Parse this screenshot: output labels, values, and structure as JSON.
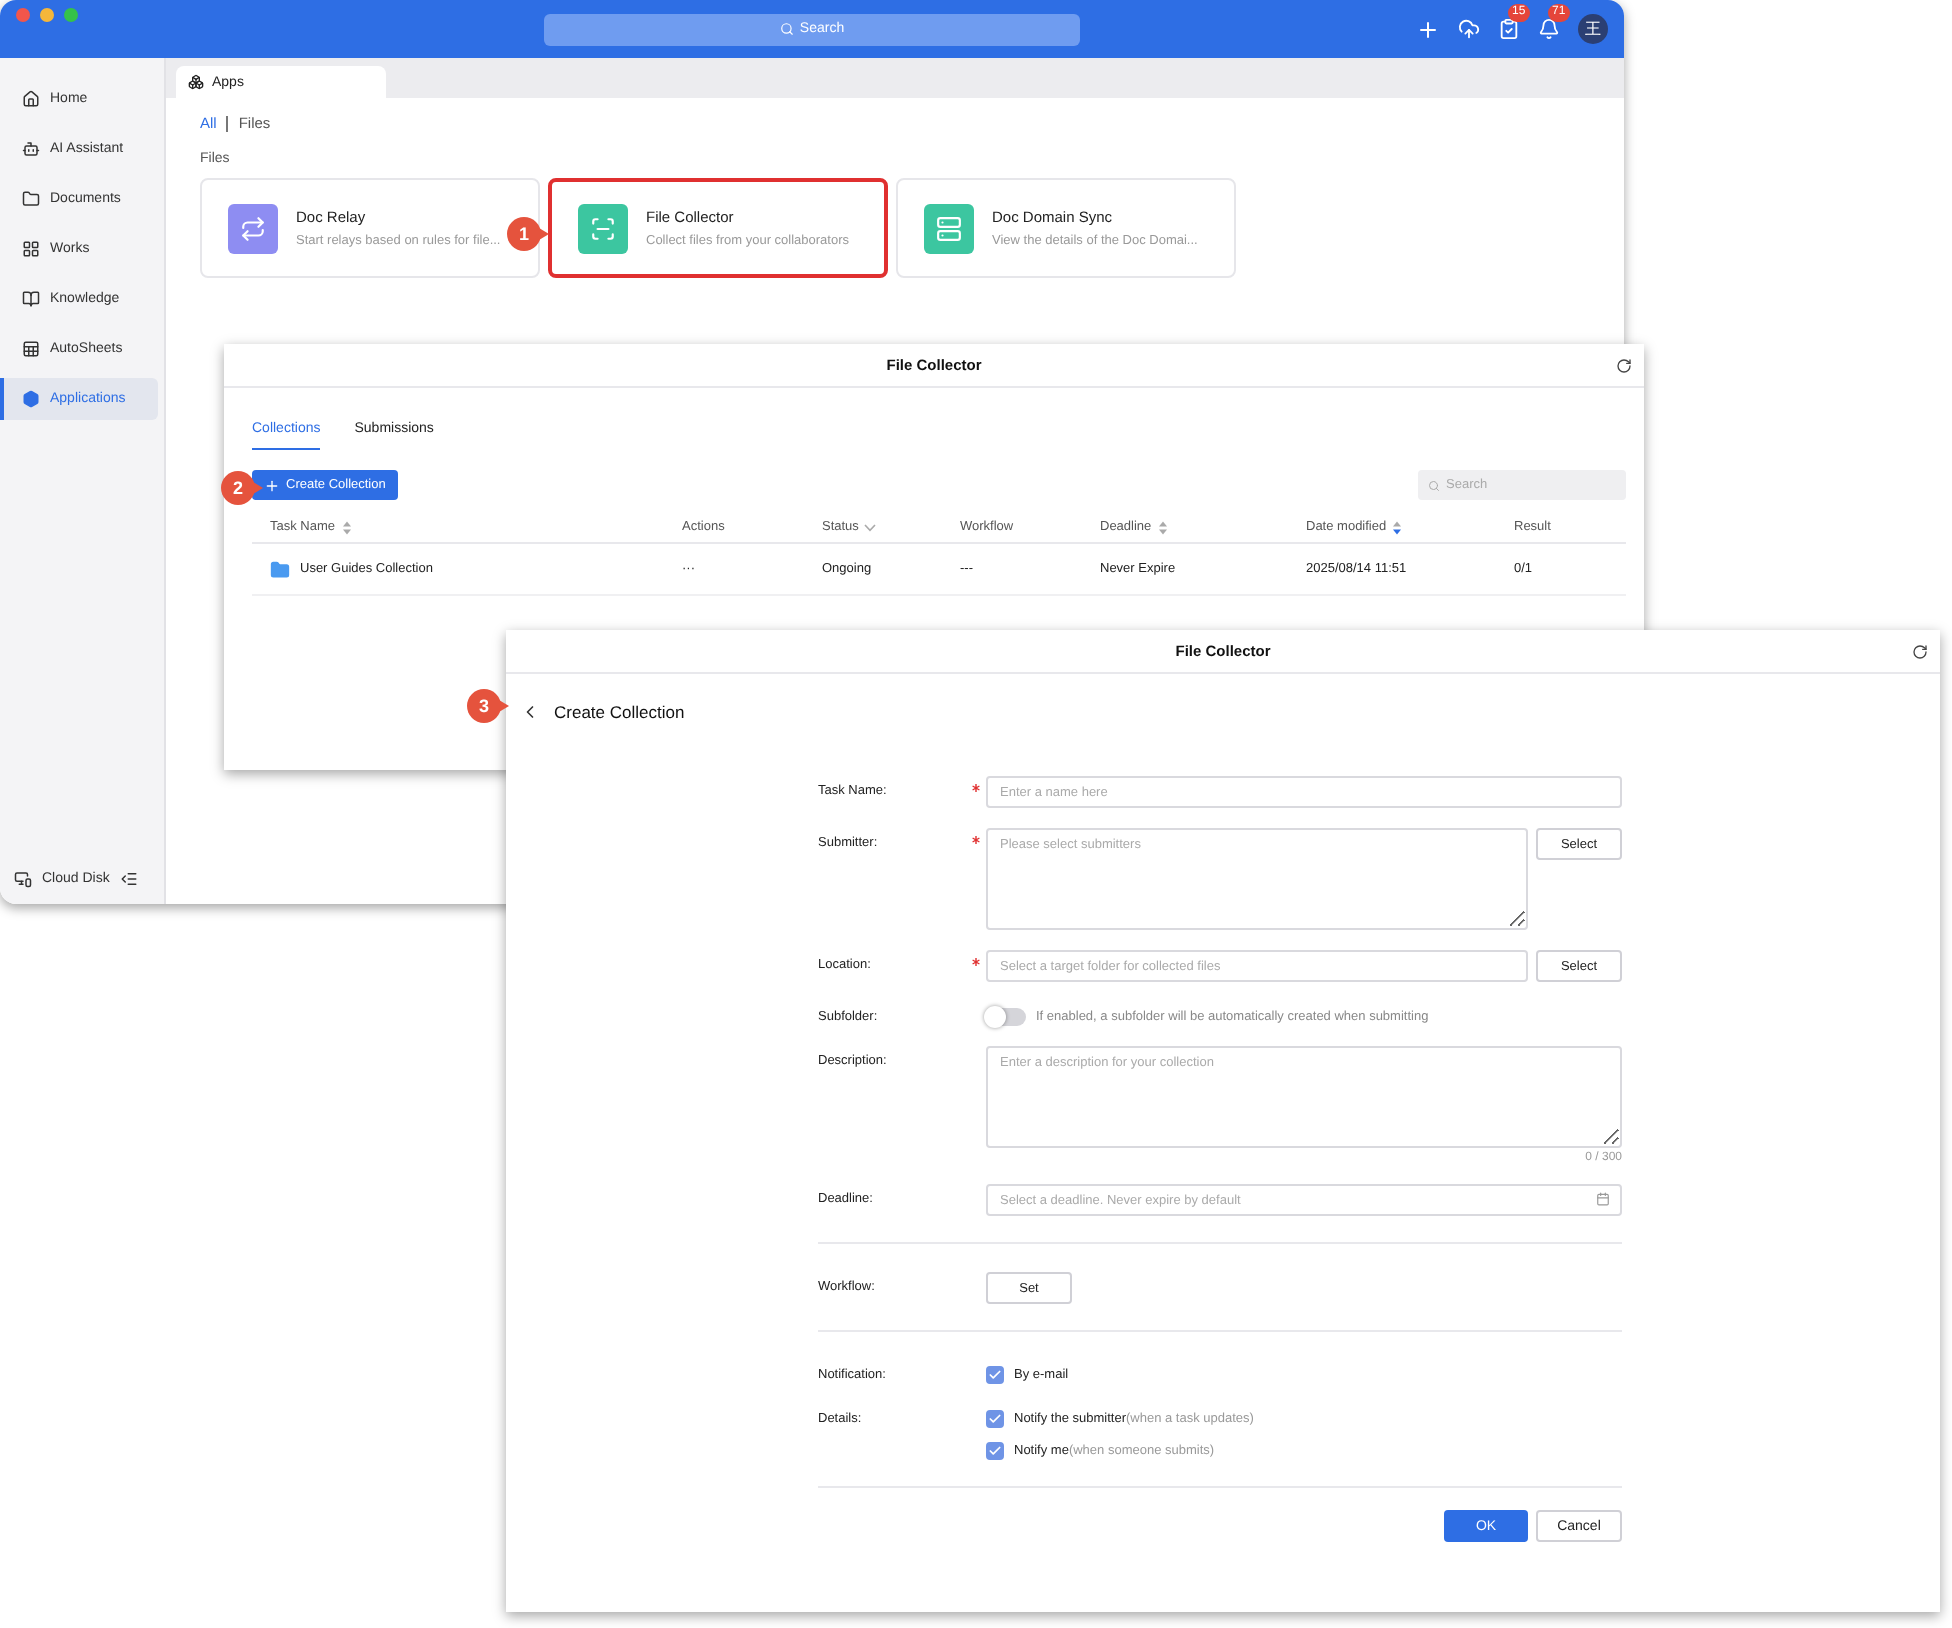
{
  "main_window": {
    "search": {
      "placeholder": "Search"
    },
    "badges": [
      "15",
      "71"
    ],
    "avatar": "王",
    "sidebar": {
      "items": [
        {
          "label": "Home",
          "selected": false
        },
        {
          "label": "AI Assistant",
          "selected": false
        },
        {
          "label": "Documents",
          "selected": false
        },
        {
          "label": "Works",
          "selected": false
        },
        {
          "label": "Knowledge",
          "selected": false
        },
        {
          "label": "AutoSheets",
          "selected": false
        },
        {
          "label": "Applications",
          "selected": true
        }
      ],
      "footer": "Cloud Disk"
    },
    "tab": "Apps",
    "filters": [
      {
        "label": "All",
        "selected": true
      },
      {
        "label": "Files",
        "selected": false
      }
    ],
    "section": "Files",
    "apps": [
      {
        "title": "Doc Relay",
        "description": "Start relays based on rules for file...",
        "highlighted": false
      },
      {
        "title": "File Collector",
        "description": "Collect files from your collaborators",
        "highlighted": true
      },
      {
        "title": "Doc Domain Sync",
        "description": "View the details of the Doc Domai...",
        "highlighted": false
      }
    ]
  },
  "collector_window": {
    "title": "File Collector",
    "tabs": [
      {
        "label": "Collections",
        "selected": true
      },
      {
        "label": "Submissions",
        "selected": false
      }
    ],
    "create_button": "Create Collection",
    "search": {
      "placeholder": "Search"
    },
    "table": {
      "columns": [
        {
          "label": "Task Name",
          "kind": "sortable"
        },
        {
          "label": "Actions",
          "kind": "plain"
        },
        {
          "label": "Status",
          "kind": "filter"
        },
        {
          "label": "Workflow",
          "kind": "plain"
        },
        {
          "label": "Deadline",
          "kind": "sortable"
        },
        {
          "label": "Date modified",
          "kind": "sorted"
        },
        {
          "label": "Result",
          "kind": "plain"
        }
      ],
      "rows": [
        [
          "User Guides Collection",
          "···",
          "Ongoing",
          "---",
          "Never Expire",
          "2025/08/14 11:51",
          "0/1"
        ]
      ]
    }
  },
  "create_window": {
    "title": "File Collector",
    "heading": "Create Collection",
    "sections": [
      [
        {
          "kind": "input",
          "label": "Task Name:",
          "required": true,
          "placeholder": "Enter a name here"
        },
        {
          "kind": "textarea_select",
          "label": "Submitter:",
          "required": true,
          "placeholder": "Please select submitters",
          "button": "Select"
        },
        {
          "kind": "input_select",
          "label": "Location:",
          "required": true,
          "placeholder": "Select a target folder for collected files",
          "button": "Select"
        },
        {
          "kind": "toggle",
          "label": "Subfolder:",
          "required": false,
          "on": false,
          "hint": "If enabled, a subfolder will be automatically created when submitting"
        },
        {
          "kind": "textarea",
          "label": "Description:",
          "required": false,
          "placeholder": "Enter a description for your collection",
          "counter": "0 / 300"
        },
        {
          "kind": "date",
          "label": "Deadline:",
          "required": false,
          "placeholder": "Select a deadline. Never expire by default"
        }
      ],
      [
        {
          "kind": "button",
          "label": "Workflow:",
          "required": false,
          "button": "Set"
        }
      ],
      [
        {
          "kind": "checkboxes",
          "label": "Notification:",
          "required": false,
          "options": [
            {
              "label": "By e-mail",
              "checked": true
            }
          ]
        },
        {
          "kind": "checkboxes",
          "label": "Details:",
          "required": false,
          "options": [
            {
              "label": "Notify the submitter",
              "note": "(when a task updates)",
              "checked": true
            },
            {
              "label": "Notify me",
              "note": "(when someone submits)",
              "checked": true
            }
          ]
        }
      ]
    ],
    "buttons": {
      "ok": "OK",
      "cancel": "Cancel"
    }
  },
  "callouts": [
    "1",
    "2",
    "3"
  ]
}
